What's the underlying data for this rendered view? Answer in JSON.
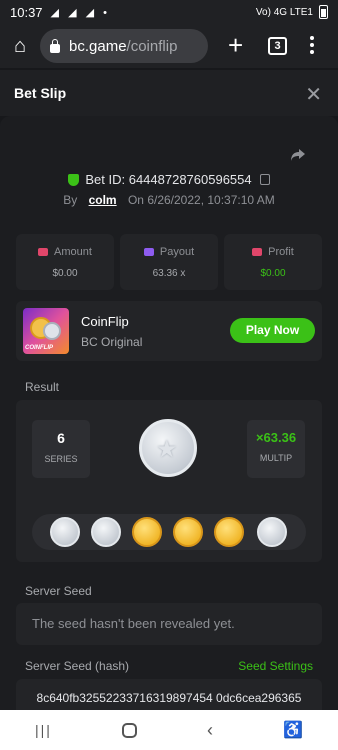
{
  "status": {
    "time": "10:37",
    "left_icons": "◢ ◢ ◢ •",
    "right_text": "Vo) 4G LTE1"
  },
  "browser": {
    "url_host": "bc.game",
    "url_path": "/coinflip",
    "tab_count": "3"
  },
  "header": {
    "title": "Bet Slip"
  },
  "bet": {
    "id_label": "Bet ID: 64448728760596554",
    "by_label": "By",
    "user": "colm",
    "on_label": "On",
    "date": "6/26/2022, 10:37:10 AM"
  },
  "stats": [
    {
      "label": "Amount",
      "value": "$0.00"
    },
    {
      "label": "Payout",
      "value": "63.36 x"
    },
    {
      "label": "Profit",
      "value": "$0.00"
    }
  ],
  "game": {
    "name": "CoinFlip",
    "provider": "BC Original",
    "play_label": "Play Now",
    "thumb_text": "COINFLIP"
  },
  "result": {
    "label": "Result",
    "series_value": "6",
    "series_label": "SERIES",
    "multiplier_value": "×63.36",
    "multiplier_label": "MULTIP",
    "coins": [
      "silver",
      "silver",
      "gold",
      "gold",
      "gold",
      "silver"
    ]
  },
  "seed": {
    "label": "Server Seed",
    "value": "The seed hasn't been revealed yet."
  },
  "hash": {
    "label": "Server Seed (hash)",
    "link": "Seed Settings",
    "value": "8c640fb32552233716319897454 0dc6cea296365"
  },
  "colors": {
    "accent": "#3bc117",
    "background": "#17181b",
    "card": "#232427"
  }
}
